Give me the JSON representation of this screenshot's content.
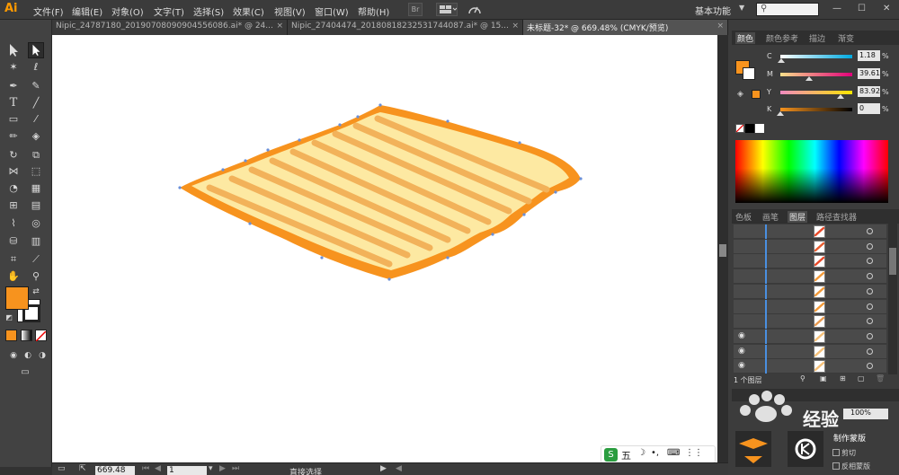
{
  "app": {
    "logo": "Ai"
  },
  "menu": [
    "文件(F)",
    "编辑(E)",
    "对象(O)",
    "文字(T)",
    "选择(S)",
    "效果(C)",
    "视图(V)",
    "窗口(W)",
    "帮助(H)"
  ],
  "menu_icons": [
    "Br"
  ],
  "workspace": {
    "label": "基本功能",
    "search_placeholder": ""
  },
  "window_controls": [
    "—",
    "☐",
    "✕"
  ],
  "tabs": [
    {
      "label": "Nipic_24787180_20190708090904556086.ai* @ 24...",
      "close": "×"
    },
    {
      "label": "Nipic_27404474_20180818232531744087.ai* @ 15...",
      "close": "×"
    },
    {
      "label": "未标题-32* @ 669.48% (CMYK/预览)",
      "close": "×"
    }
  ],
  "colors": {
    "fill": "#f7931e",
    "accent_orange": "#f7931e",
    "light_yellow": "#fdeaa0",
    "stripe": "#f2b25a",
    "layer_blue": "#4a8fe0"
  },
  "status": {
    "zoom": "669.48",
    "page": "1",
    "tool_text": "直接选择"
  },
  "color_panel": {
    "tabs": [
      "颜色",
      "颜色参考",
      "描边",
      "渐变"
    ],
    "sliders": [
      {
        "label": "C",
        "value": "1.18",
        "pct": "%",
        "level": 0.012
      },
      {
        "label": "M",
        "value": "39.61",
        "pct": "%",
        "level": 0.396
      },
      {
        "label": "Y",
        "value": "83.92",
        "pct": "%",
        "level": 0.839
      },
      {
        "label": "K",
        "value": "0",
        "pct": "%",
        "level": 0.0
      }
    ]
  },
  "layers_panel": {
    "tabs": [
      "色板",
      "画笔",
      "图层",
      "路径查找器"
    ],
    "footer": "1 个图层",
    "rows": 10,
    "eye_rows": [
      7,
      8,
      9
    ]
  },
  "mask_panel": {
    "title": "经验",
    "make_mask_label": "制作蒙版",
    "clip_label": "剪切",
    "invert_label": "反相蒙版",
    "opacity_value": "100%"
  },
  "ime": {
    "label": "五"
  },
  "icons": {
    "tools": [
      "selection-icon",
      "direct-selection-icon",
      "magic-wand-icon",
      "lasso-icon",
      "pen-icon",
      "curvature-icon",
      "type-icon",
      "line-icon",
      "rectangle-icon",
      "paintbrush-icon",
      "pencil-icon",
      "eraser-icon",
      "rotate-icon",
      "scale-icon",
      "width-icon",
      "free-transform-icon",
      "shape-builder-icon",
      "perspective-icon",
      "mesh-icon",
      "gradient-icon",
      "eyedropper-icon",
      "blend-icon",
      "symbol-sprayer-icon",
      "column-graph-icon",
      "artboard-icon",
      "slice-icon",
      "hand-icon",
      "zoom-icon"
    ]
  }
}
